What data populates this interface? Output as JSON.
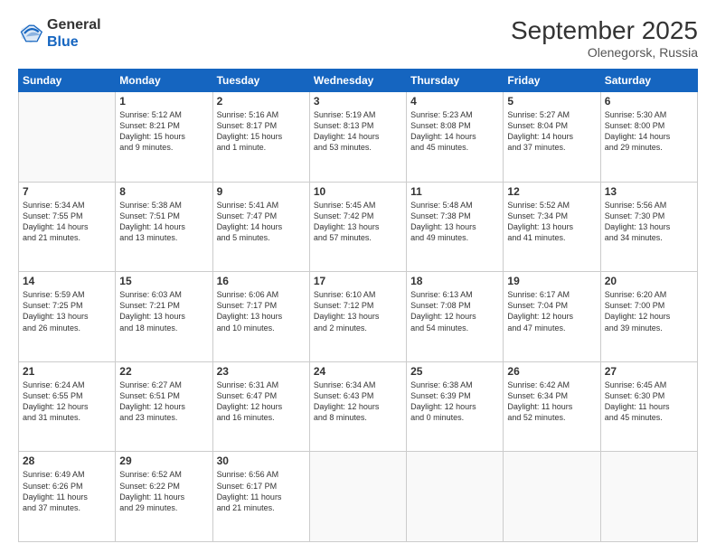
{
  "header": {
    "logo_line1": "General",
    "logo_line2": "Blue",
    "month": "September 2025",
    "location": "Olenegorsk, Russia"
  },
  "days_of_week": [
    "Sunday",
    "Monday",
    "Tuesday",
    "Wednesday",
    "Thursday",
    "Friday",
    "Saturday"
  ],
  "weeks": [
    [
      {
        "day": "",
        "info": ""
      },
      {
        "day": "1",
        "info": "Sunrise: 5:12 AM\nSunset: 8:21 PM\nDaylight: 15 hours\nand 9 minutes."
      },
      {
        "day": "2",
        "info": "Sunrise: 5:16 AM\nSunset: 8:17 PM\nDaylight: 15 hours\nand 1 minute."
      },
      {
        "day": "3",
        "info": "Sunrise: 5:19 AM\nSunset: 8:13 PM\nDaylight: 14 hours\nand 53 minutes."
      },
      {
        "day": "4",
        "info": "Sunrise: 5:23 AM\nSunset: 8:08 PM\nDaylight: 14 hours\nand 45 minutes."
      },
      {
        "day": "5",
        "info": "Sunrise: 5:27 AM\nSunset: 8:04 PM\nDaylight: 14 hours\nand 37 minutes."
      },
      {
        "day": "6",
        "info": "Sunrise: 5:30 AM\nSunset: 8:00 PM\nDaylight: 14 hours\nand 29 minutes."
      }
    ],
    [
      {
        "day": "7",
        "info": "Sunrise: 5:34 AM\nSunset: 7:55 PM\nDaylight: 14 hours\nand 21 minutes."
      },
      {
        "day": "8",
        "info": "Sunrise: 5:38 AM\nSunset: 7:51 PM\nDaylight: 14 hours\nand 13 minutes."
      },
      {
        "day": "9",
        "info": "Sunrise: 5:41 AM\nSunset: 7:47 PM\nDaylight: 14 hours\nand 5 minutes."
      },
      {
        "day": "10",
        "info": "Sunrise: 5:45 AM\nSunset: 7:42 PM\nDaylight: 13 hours\nand 57 minutes."
      },
      {
        "day": "11",
        "info": "Sunrise: 5:48 AM\nSunset: 7:38 PM\nDaylight: 13 hours\nand 49 minutes."
      },
      {
        "day": "12",
        "info": "Sunrise: 5:52 AM\nSunset: 7:34 PM\nDaylight: 13 hours\nand 41 minutes."
      },
      {
        "day": "13",
        "info": "Sunrise: 5:56 AM\nSunset: 7:30 PM\nDaylight: 13 hours\nand 34 minutes."
      }
    ],
    [
      {
        "day": "14",
        "info": "Sunrise: 5:59 AM\nSunset: 7:25 PM\nDaylight: 13 hours\nand 26 minutes."
      },
      {
        "day": "15",
        "info": "Sunrise: 6:03 AM\nSunset: 7:21 PM\nDaylight: 13 hours\nand 18 minutes."
      },
      {
        "day": "16",
        "info": "Sunrise: 6:06 AM\nSunset: 7:17 PM\nDaylight: 13 hours\nand 10 minutes."
      },
      {
        "day": "17",
        "info": "Sunrise: 6:10 AM\nSunset: 7:12 PM\nDaylight: 13 hours\nand 2 minutes."
      },
      {
        "day": "18",
        "info": "Sunrise: 6:13 AM\nSunset: 7:08 PM\nDaylight: 12 hours\nand 54 minutes."
      },
      {
        "day": "19",
        "info": "Sunrise: 6:17 AM\nSunset: 7:04 PM\nDaylight: 12 hours\nand 47 minutes."
      },
      {
        "day": "20",
        "info": "Sunrise: 6:20 AM\nSunset: 7:00 PM\nDaylight: 12 hours\nand 39 minutes."
      }
    ],
    [
      {
        "day": "21",
        "info": "Sunrise: 6:24 AM\nSunset: 6:55 PM\nDaylight: 12 hours\nand 31 minutes."
      },
      {
        "day": "22",
        "info": "Sunrise: 6:27 AM\nSunset: 6:51 PM\nDaylight: 12 hours\nand 23 minutes."
      },
      {
        "day": "23",
        "info": "Sunrise: 6:31 AM\nSunset: 6:47 PM\nDaylight: 12 hours\nand 16 minutes."
      },
      {
        "day": "24",
        "info": "Sunrise: 6:34 AM\nSunset: 6:43 PM\nDaylight: 12 hours\nand 8 minutes."
      },
      {
        "day": "25",
        "info": "Sunrise: 6:38 AM\nSunset: 6:39 PM\nDaylight: 12 hours\nand 0 minutes."
      },
      {
        "day": "26",
        "info": "Sunrise: 6:42 AM\nSunset: 6:34 PM\nDaylight: 11 hours\nand 52 minutes."
      },
      {
        "day": "27",
        "info": "Sunrise: 6:45 AM\nSunset: 6:30 PM\nDaylight: 11 hours\nand 45 minutes."
      }
    ],
    [
      {
        "day": "28",
        "info": "Sunrise: 6:49 AM\nSunset: 6:26 PM\nDaylight: 11 hours\nand 37 minutes."
      },
      {
        "day": "29",
        "info": "Sunrise: 6:52 AM\nSunset: 6:22 PM\nDaylight: 11 hours\nand 29 minutes."
      },
      {
        "day": "30",
        "info": "Sunrise: 6:56 AM\nSunset: 6:17 PM\nDaylight: 11 hours\nand 21 minutes."
      },
      {
        "day": "",
        "info": ""
      },
      {
        "day": "",
        "info": ""
      },
      {
        "day": "",
        "info": ""
      },
      {
        "day": "",
        "info": ""
      }
    ]
  ]
}
